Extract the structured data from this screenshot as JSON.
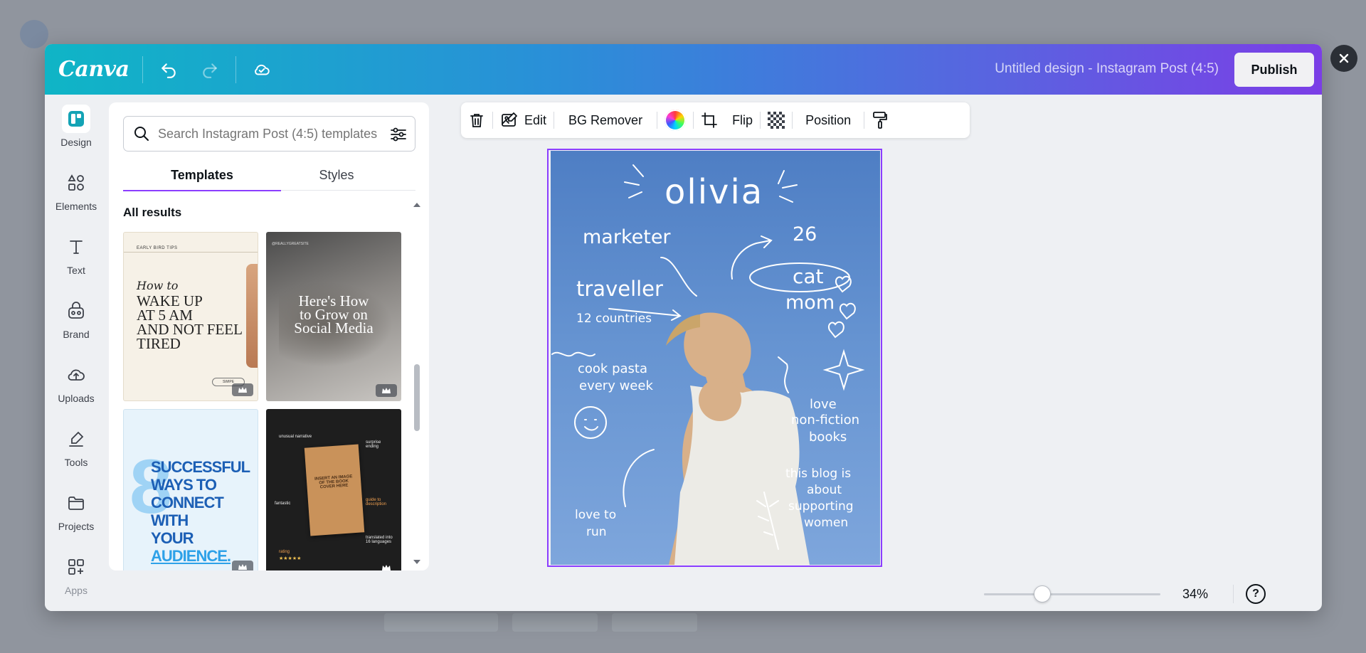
{
  "app": {
    "logo": "Canva",
    "doc_title": "Untitled design - Instagram Post (4:5)",
    "publish_label": "Publish",
    "accent": "#8b3dff"
  },
  "rail": {
    "items": [
      {
        "label": "Design",
        "icon": "design-icon"
      },
      {
        "label": "Elements",
        "icon": "elements-icon"
      },
      {
        "label": "Text",
        "icon": "text-icon"
      },
      {
        "label": "Brand",
        "icon": "brand-icon"
      },
      {
        "label": "Uploads",
        "icon": "uploads-icon"
      },
      {
        "label": "Tools",
        "icon": "tools-icon"
      },
      {
        "label": "Projects",
        "icon": "projects-icon"
      },
      {
        "label": "Apps",
        "icon": "apps-icon"
      }
    ]
  },
  "panel": {
    "search_placeholder": "Search Instagram Post (4:5) templates",
    "tabs": [
      "Templates",
      "Styles"
    ],
    "section_title": "All results",
    "templates": [
      {
        "lines": [
          "EARLY BIRD TIPS",
          "How to",
          "WAKE UP",
          "AT 5 AM",
          "AND NOT FEEL",
          "TIRED",
          "SWIPE"
        ]
      },
      {
        "lines": [
          "@REALLYGREATSITE",
          "Here's How",
          "to Grow on",
          "Social Media"
        ]
      },
      {
        "lines": [
          "8",
          "SUCCESSFUL",
          "WAYS TO",
          "CONNECT WITH",
          "YOUR",
          "AUDIENCE."
        ]
      },
      {
        "lines": [
          "unusual narrative",
          "surprise ending",
          "INSERT AN IMAGE OF THE BOOK COVER HERE",
          "fantastic",
          "guide to description",
          "rating",
          "translated into 16 languages"
        ]
      }
    ]
  },
  "toolbar": {
    "edit": "Edit",
    "bg_remover": "BG Remover",
    "flip": "Flip",
    "position": "Position"
  },
  "design": {
    "name": "olivia",
    "notes": [
      "marketer",
      "26",
      "traveller",
      "cat",
      "mom",
      "12 countries",
      "cook pasta",
      "every week",
      "love",
      "non-fiction",
      "books",
      "this blog is",
      "about",
      "supporting",
      "women",
      "love to",
      "run"
    ]
  },
  "zoom": {
    "value": "34%",
    "level": 0.34
  },
  "help": "?"
}
